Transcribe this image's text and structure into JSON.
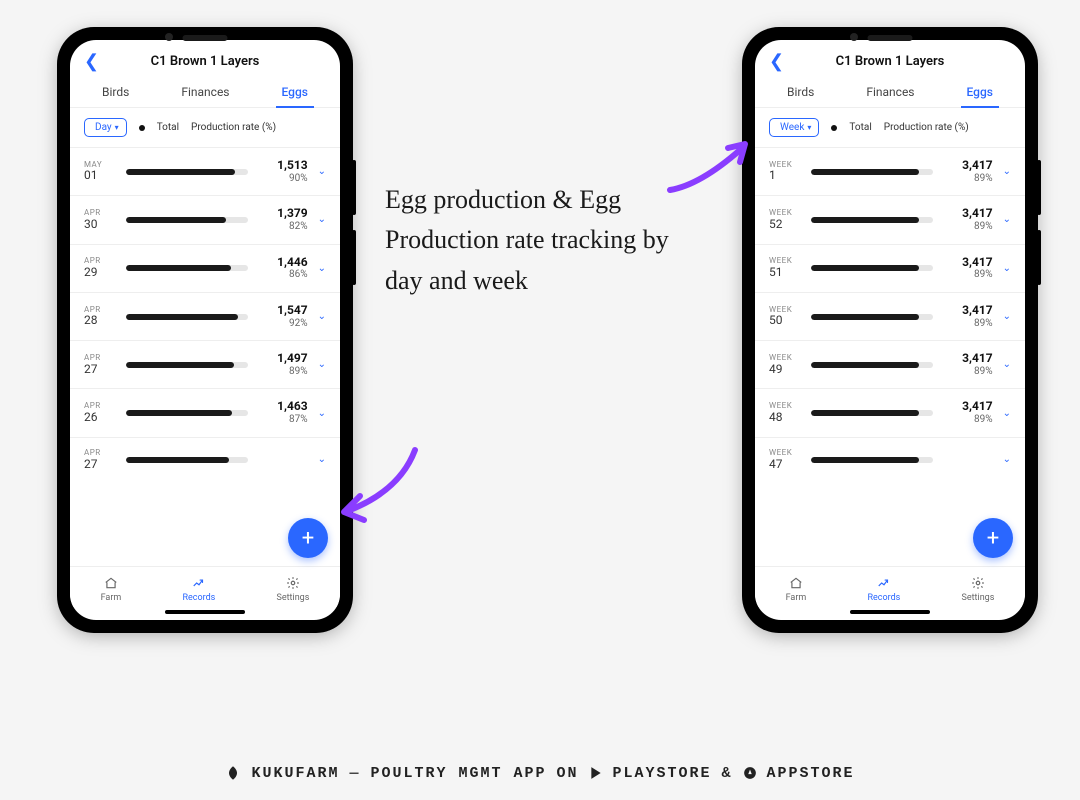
{
  "phones": {
    "left": {
      "title": "C1 Brown 1 Layers",
      "tabs": [
        "Birds",
        "Finances",
        "Eggs"
      ],
      "active_tab": "Eggs",
      "period": "Day",
      "legend_total": "Total",
      "legend_rate": "Production rate (%)",
      "rows": [
        {
          "d1": "MAY",
          "d2": "01",
          "val": "1,513",
          "pct": "90%",
          "fill": 90
        },
        {
          "d1": "APR",
          "d2": "30",
          "val": "1,379",
          "pct": "82%",
          "fill": 82
        },
        {
          "d1": "APR",
          "d2": "29",
          "val": "1,446",
          "pct": "86%",
          "fill": 86
        },
        {
          "d1": "APR",
          "d2": "28",
          "val": "1,547",
          "pct": "92%",
          "fill": 92
        },
        {
          "d1": "APR",
          "d2": "27",
          "val": "1,497",
          "pct": "89%",
          "fill": 89
        },
        {
          "d1": "APR",
          "d2": "26",
          "val": "1,463",
          "pct": "87%",
          "fill": 87
        },
        {
          "d1": "APR",
          "d2": "27",
          "val": "",
          "pct": "",
          "fill": 85
        }
      ],
      "bottomnav": {
        "farm": "Farm",
        "records": "Records",
        "settings": "Settings",
        "active": "records"
      }
    },
    "right": {
      "title": "C1 Brown 1 Layers",
      "tabs": [
        "Birds",
        "Finances",
        "Eggs"
      ],
      "active_tab": "Eggs",
      "period": "Week",
      "legend_total": "Total",
      "legend_rate": "Production rate (%)",
      "rows": [
        {
          "d1": "WEEK",
          "d2": "1",
          "val": "3,417",
          "pct": "89%",
          "fill": 89
        },
        {
          "d1": "WEEK",
          "d2": "52",
          "val": "3,417",
          "pct": "89%",
          "fill": 89
        },
        {
          "d1": "WEEK",
          "d2": "51",
          "val": "3,417",
          "pct": "89%",
          "fill": 89
        },
        {
          "d1": "WEEK",
          "d2": "50",
          "val": "3,417",
          "pct": "89%",
          "fill": 89
        },
        {
          "d1": "WEEK",
          "d2": "49",
          "val": "3,417",
          "pct": "89%",
          "fill": 89
        },
        {
          "d1": "WEEK",
          "d2": "48",
          "val": "3,417",
          "pct": "89%",
          "fill": 89
        },
        {
          "d1": "WEEK",
          "d2": "47",
          "val": "",
          "pct": "",
          "fill": 89
        }
      ],
      "bottomnav": {
        "farm": "Farm",
        "records": "Records",
        "settings": "Settings",
        "active": "records"
      }
    }
  },
  "annotation": "Egg production & Egg Production rate tracking by day and week",
  "footer": {
    "brand": "KUKUFARM",
    "tagline_pre": "POULTRY MGMT APP",
    "on": "ON",
    "playstore": "PLAYSTORE",
    "amp": "&",
    "appstore": "APPSTORE"
  },
  "colors": {
    "accent": "#2a67ff",
    "arrow": "#8a3dff"
  }
}
